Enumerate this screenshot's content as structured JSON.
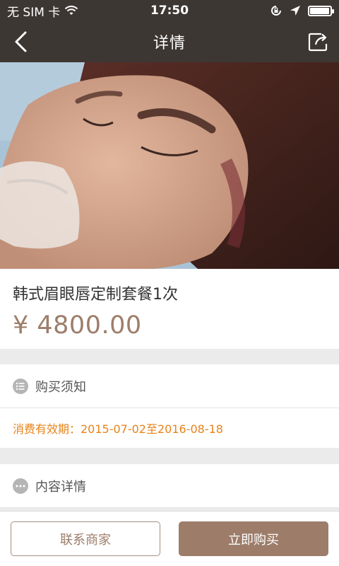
{
  "status_bar": {
    "carrier": "无 SIM 卡",
    "time": "17:50",
    "battery_level": 0.95
  },
  "header": {
    "title": "详情",
    "back_icon": "chevron-left-icon",
    "share_icon": "share-icon"
  },
  "hero": {
    "description": "photo-of-face-with-microblading-eyebrows"
  },
  "product": {
    "name": "韩式眉眼唇定制套餐1次",
    "price": "¥ 4800.00"
  },
  "notice": {
    "label": "购买须知",
    "icon": "list-icon",
    "validity": "消费有效期：2015-07-02至2016-08-18"
  },
  "details": {
    "label": "内容详情",
    "icon": "more-icon"
  },
  "actions": {
    "contact_label": "联系商家",
    "buy_label": "立即购买"
  },
  "colors": {
    "bar": "#3d3733",
    "accent": "#9d7d6a",
    "validity": "#e8831a"
  }
}
